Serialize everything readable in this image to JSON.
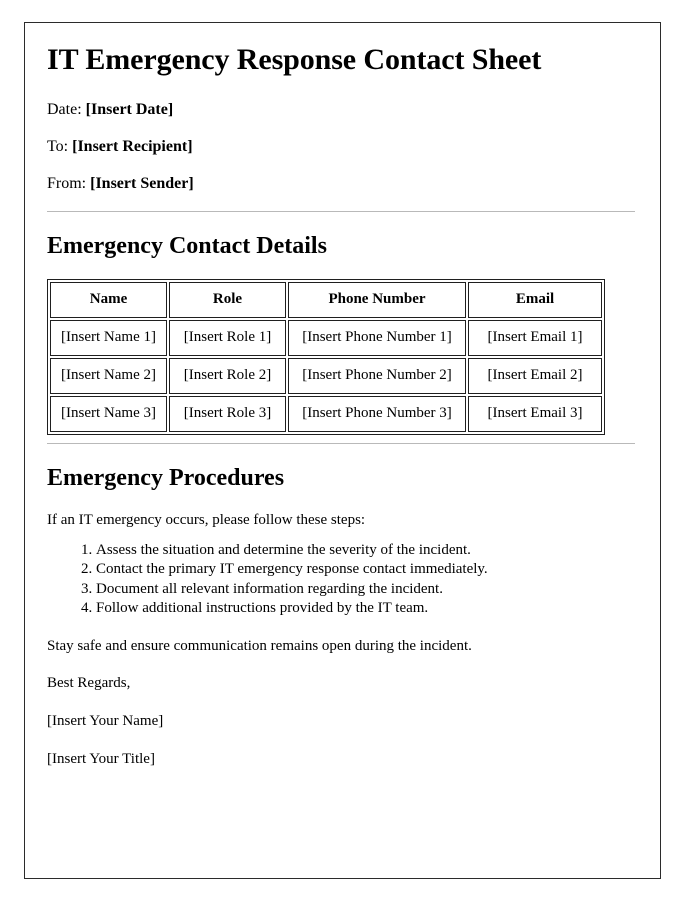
{
  "document": {
    "title": "IT Emergency Response Contact Sheet",
    "meta": [
      {
        "label": "Date:",
        "value": "[Insert Date]"
      },
      {
        "label": "To:",
        "value": "[Insert Recipient]"
      },
      {
        "label": "From:",
        "value": "[Insert Sender]"
      }
    ],
    "contact_section": {
      "heading": "Emergency Contact Details",
      "table": {
        "columns": [
          "Name",
          "Role",
          "Phone Number",
          "Email"
        ],
        "rows": [
          [
            "[Insert Name 1]",
            "[Insert Role 1]",
            "[Insert Phone Number 1]",
            "[Insert Email 1]"
          ],
          [
            "[Insert Name 2]",
            "[Insert Role 2]",
            "[Insert Phone Number 2]",
            "[Insert Email 2]"
          ],
          [
            "[Insert Name 3]",
            "[Insert Role 3]",
            "[Insert Phone Number 3]",
            "[Insert Email 3]"
          ]
        ]
      }
    },
    "procedures_section": {
      "heading": "Emergency Procedures",
      "intro": "If an IT emergency occurs, please follow these steps:",
      "steps": [
        "Assess the situation and determine the severity of the incident.",
        "Contact the primary IT emergency response contact immediately.",
        "Document all relevant information regarding the incident.",
        "Follow additional instructions provided by the IT team."
      ],
      "note": "Stay safe and ensure communication remains open during the incident."
    },
    "closing": {
      "salutation": "Best Regards,",
      "name": "[Insert Your Name]",
      "title": "[Insert Your Title]"
    }
  }
}
